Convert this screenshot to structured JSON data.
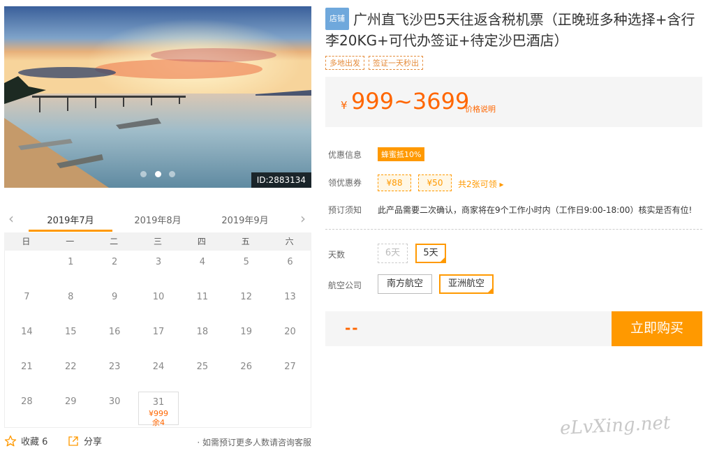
{
  "gallery": {
    "image_id": "ID:2883134",
    "dots": 3,
    "active_dot": 1
  },
  "calendar": {
    "months": [
      "2019年7月",
      "2019年8月",
      "2019年9月"
    ],
    "active_month": 0,
    "weekdays": [
      "日",
      "一",
      "二",
      "三",
      "四",
      "五",
      "六"
    ],
    "start_offset": 1,
    "days_in_month": 31,
    "available": {
      "31": {
        "price": "¥999",
        "stock": "余4"
      }
    }
  },
  "footer": {
    "favorite_label": "收藏 6",
    "share_label": "分享",
    "note": "· 如需预订更多人数请咨询客服"
  },
  "product": {
    "shop_tag": "店铺",
    "title": "广州直飞沙巴5天往返含税机票（正晚班多种选择+含行李20KG+可代办签证+待定沙巴酒店）",
    "tags": [
      "多地出发",
      "签证一天秒出"
    ]
  },
  "price": {
    "yen": "¥",
    "range": "999~3699",
    "note": "价格说明"
  },
  "info": {
    "discount_label": "优惠信息",
    "discount_value": "蜂蜜抵10%",
    "coupon_label": "领优惠券",
    "coupons": [
      "¥88",
      "¥50"
    ],
    "coupon_link": "共2张可领 ▸",
    "notice_label": "预订须知",
    "notice_text": "此产品需要二次确认，商家将在9个工作小时内（工作日9:00-18:00）核实是否有位!"
  },
  "options": {
    "days_label": "天数",
    "days": [
      {
        "label": "6天",
        "state": "disabled"
      },
      {
        "label": "5天",
        "state": "selected"
      }
    ],
    "airline_label": "航空公司",
    "airlines": [
      {
        "label": "南方航空",
        "state": "normal"
      },
      {
        "label": "亚洲航空",
        "state": "selected"
      }
    ]
  },
  "buy": {
    "placeholder": "--",
    "button_label": "立即购买"
  },
  "watermark": "eLvXing.net",
  "colors": {
    "accent": "#ff9900",
    "price": "#ff6600",
    "shop_tag": "#6fa8dc"
  }
}
